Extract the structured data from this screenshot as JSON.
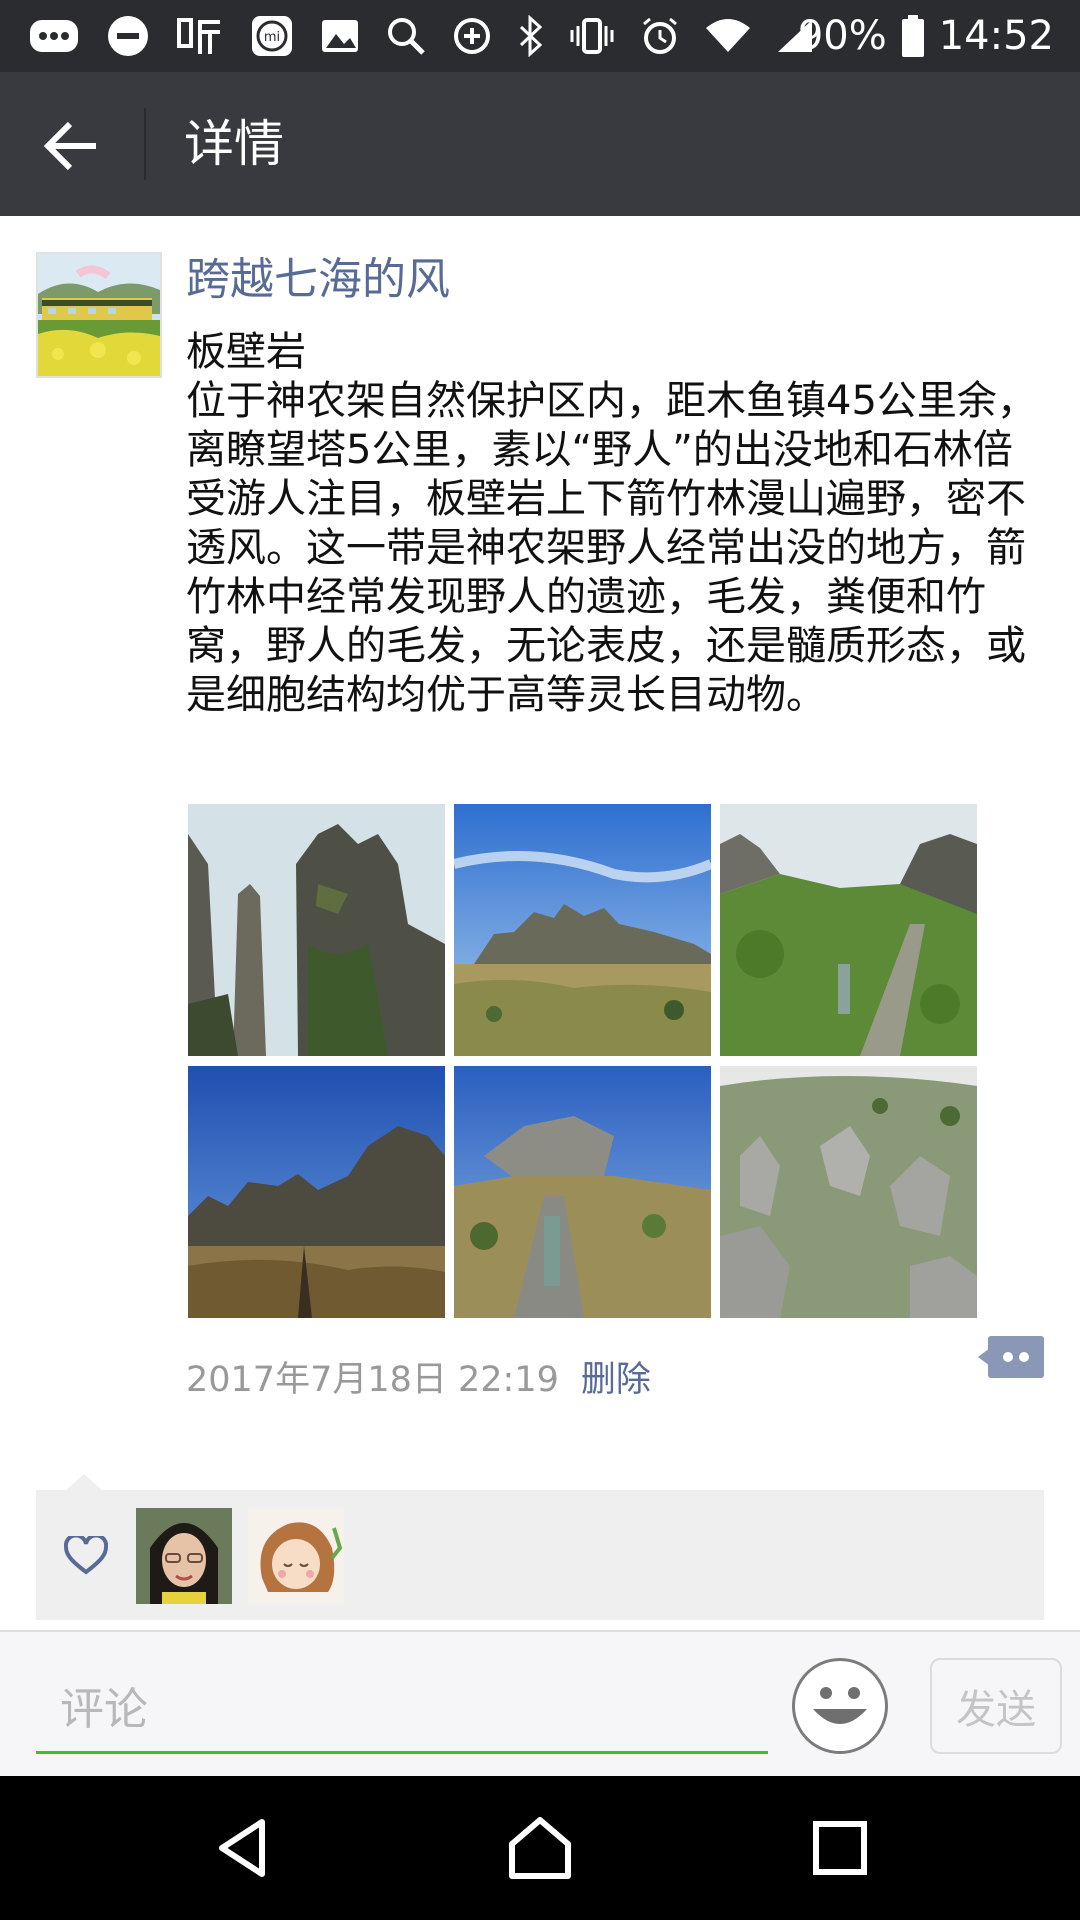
{
  "status_bar": {
    "battery": "90%",
    "time": "14:52"
  },
  "header": {
    "title": "详情"
  },
  "post": {
    "username": "跨越七海的风",
    "text": "板壁岩\n位于神农架自然保护区内，距木鱼镇45公里余，离瞭望塔5公里，素以“野人”的出没地和石林倍受游人注目，板壁岩上下箭竹林漫山遍野，密不透风。这一带是神农架野人经常出没的地方，箭竹林中经常发现野人的遗迹，毛发，粪便和竹窝，野人的毛发，无论表皮，还是髓质形态，或是细胞结构均优于高等灵长目动物。",
    "timestamp": "2017年7月18日 22:19",
    "delete_label": "删除",
    "photo_count": 6
  },
  "comment_bar": {
    "placeholder": "评论",
    "send_label": "发送"
  },
  "colors": {
    "link": "#576b95",
    "header_bg": "#393a3f",
    "status_bg": "#2b2c2f",
    "input_underline": "#45c01a"
  }
}
